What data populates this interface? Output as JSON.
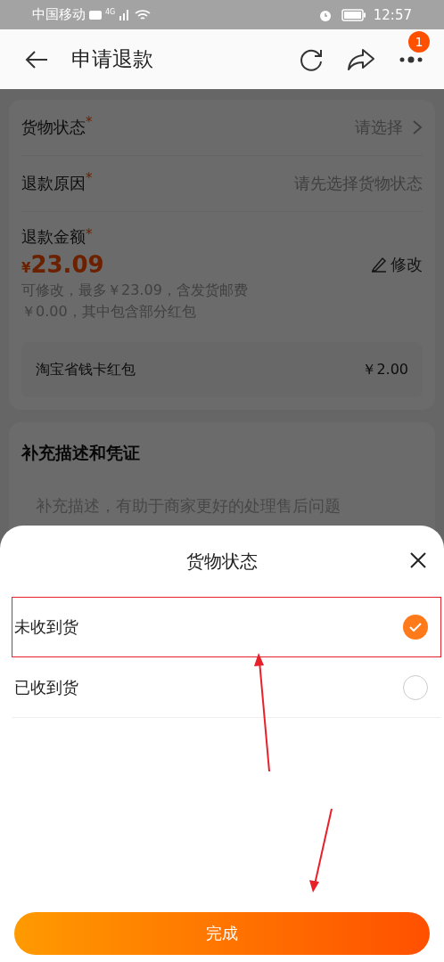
{
  "status_bar": {
    "carrier": "中国移动",
    "network": "4G",
    "time": "12:57"
  },
  "header": {
    "title": "申请退款",
    "badge": "1"
  },
  "form": {
    "rows": [
      {
        "label": "货物状态",
        "mark": "*",
        "value": "请选择",
        "kind": "select"
      },
      {
        "label": "退款原因",
        "mark": "*",
        "value": "请先选择货物状态",
        "kind": "text"
      }
    ],
    "amount": {
      "label": "退款金额",
      "mark": "*",
      "currency": "¥",
      "value": "23.09",
      "edit": "修改",
      "note": "可修改，最多￥23.09，含发货邮费￥0.00，其中包含部分红包",
      "bonus": {
        "label": "淘宝省钱卡红包",
        "value": "￥2.00"
      }
    }
  },
  "evidence": {
    "title": "补充描述和凭证",
    "placeholder": "补充描述，有助于商家更好的处理售后问题"
  },
  "sheet": {
    "title": "货物状态",
    "options": [
      {
        "label": "未收到货",
        "selected": true,
        "annotated": true
      },
      {
        "label": "已收到货",
        "selected": false,
        "annotated": false
      }
    ],
    "button": "完成"
  }
}
